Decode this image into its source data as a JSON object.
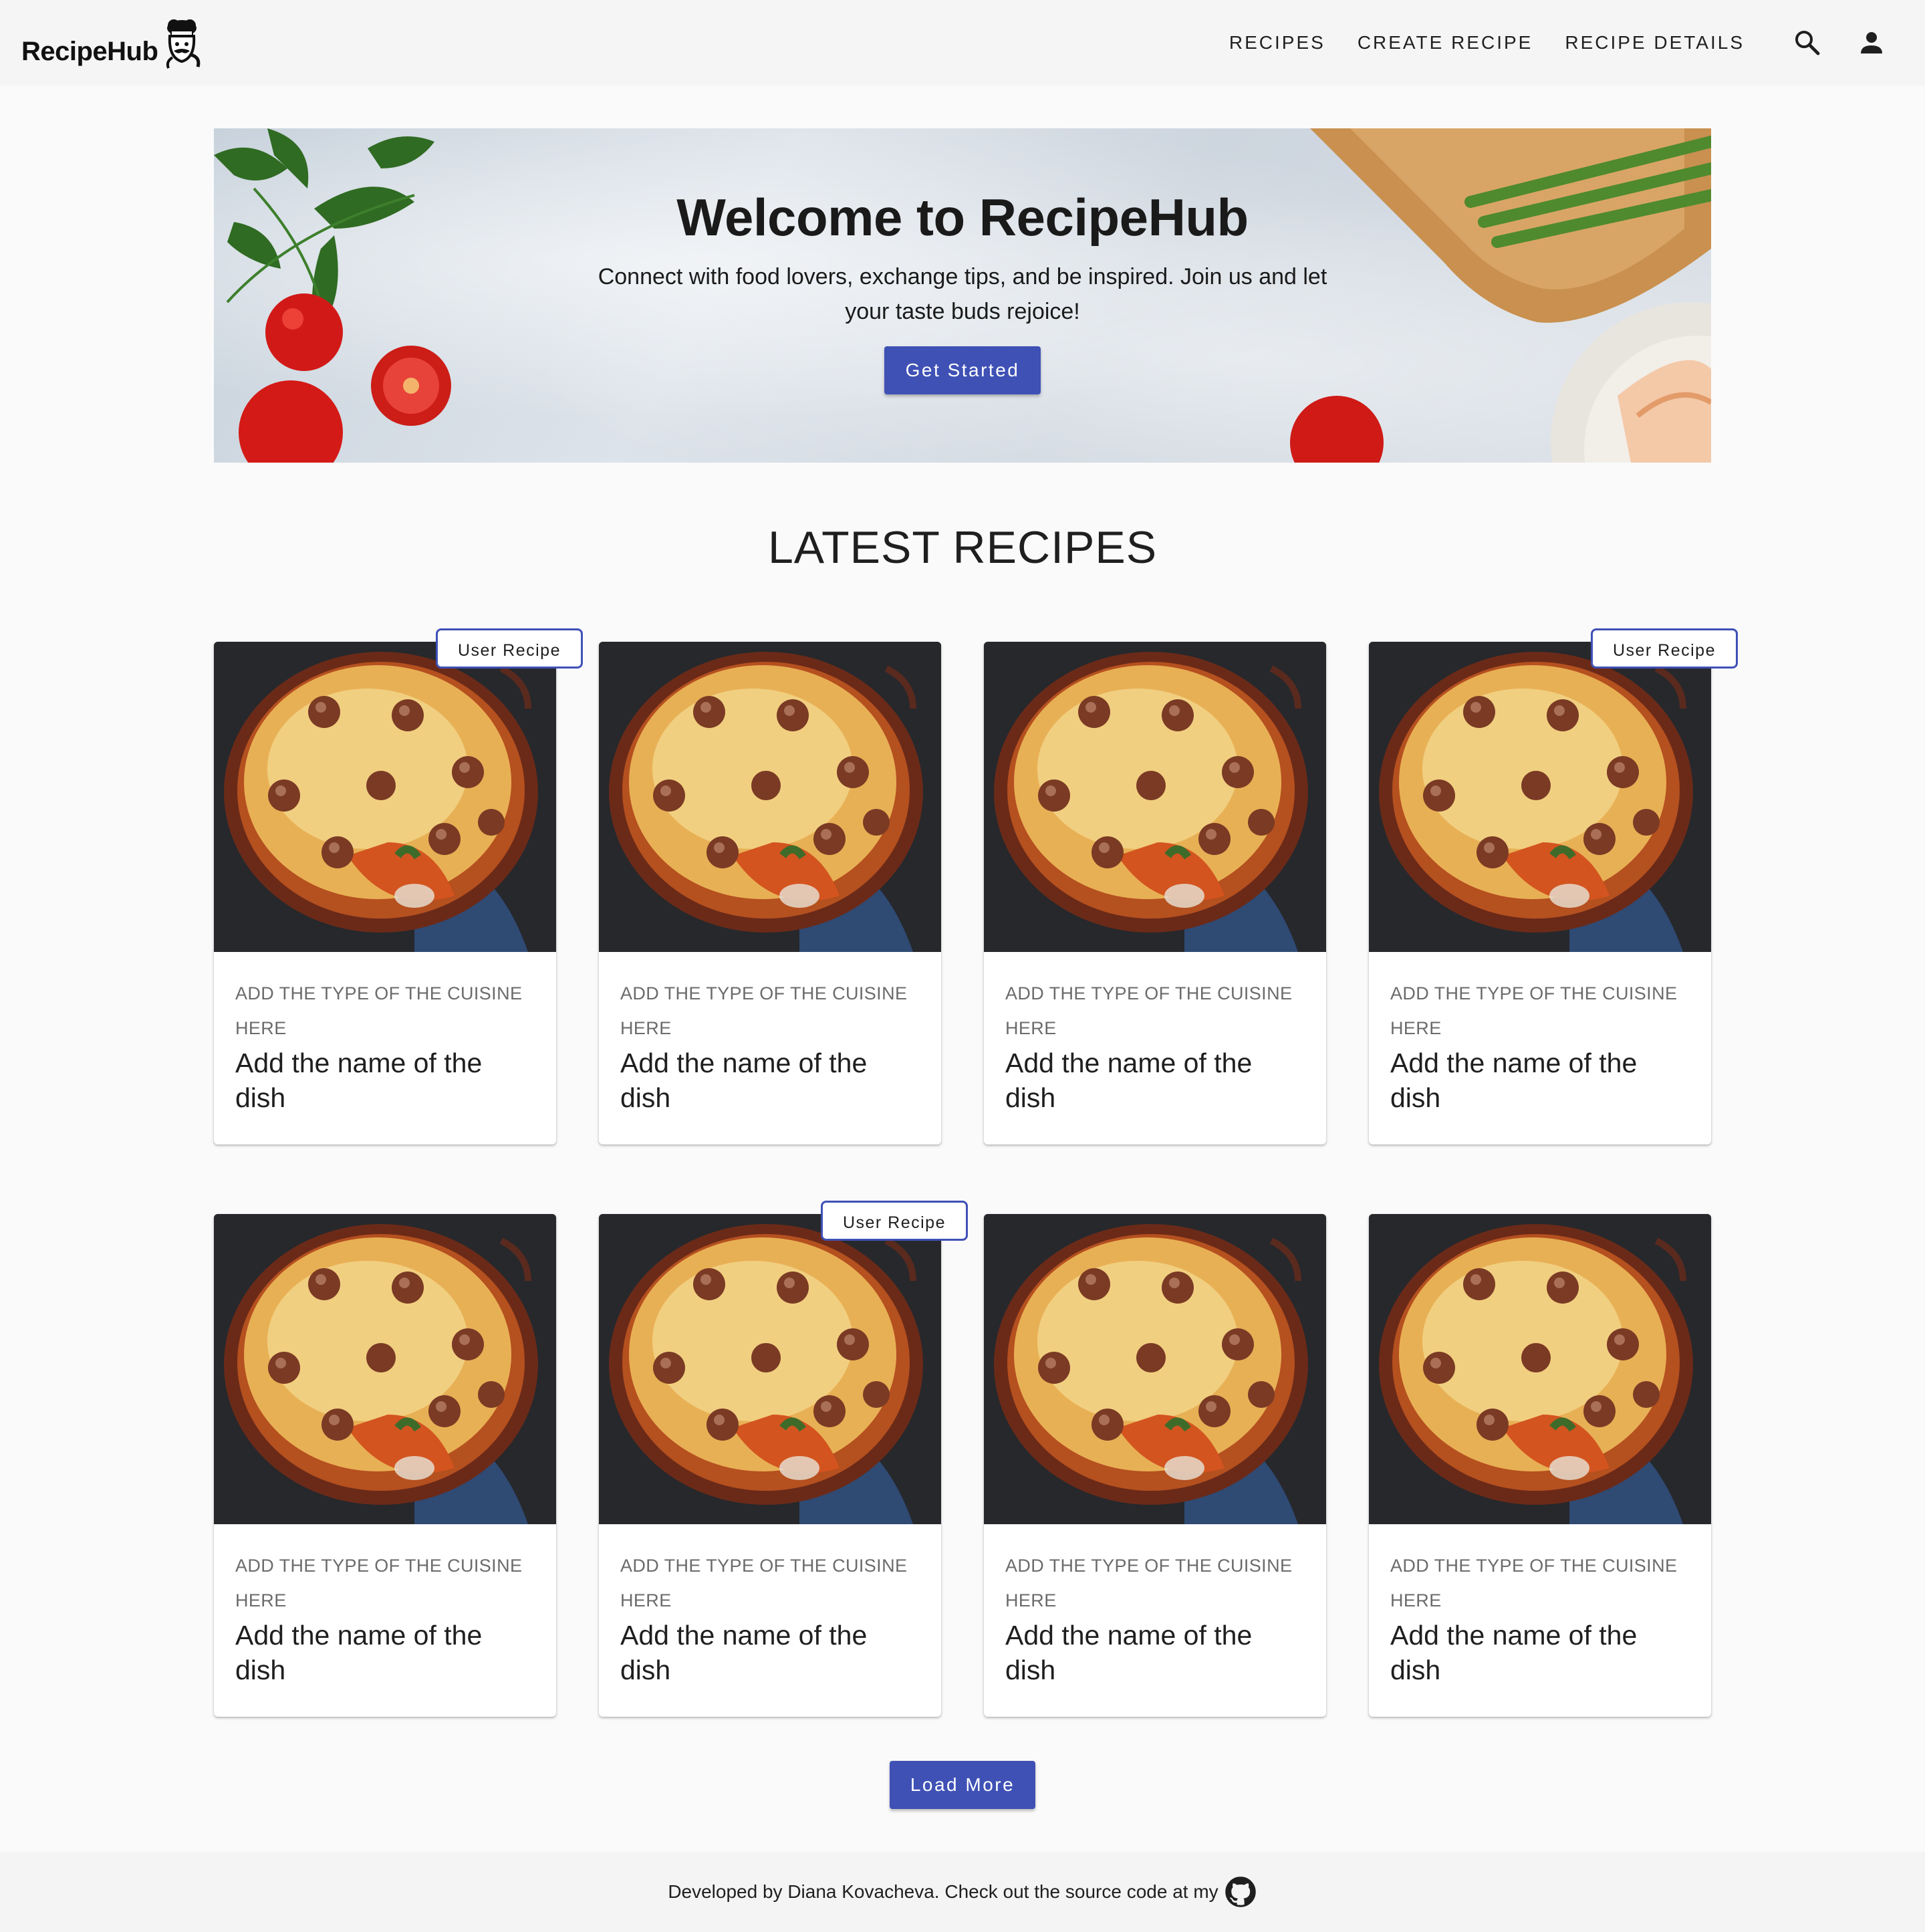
{
  "header": {
    "brand": "RecipeHub",
    "nav": [
      "RECIPES",
      "CREATE RECIPE",
      "RECIPE DETAILS"
    ],
    "search_icon": "search-icon",
    "account_icon": "account-icon"
  },
  "hero": {
    "title": "Welcome to RecipeHub",
    "subtitle": "Connect with food lovers, exchange tips, and be inspired. Join us and let your taste buds rejoice!",
    "cta": "Get Started"
  },
  "latest": {
    "title": "LATEST RECIPES",
    "cards": [
      {
        "type": "ADD THE TYPE OF THE CUISINE HERE",
        "name": "Add the name of the dish",
        "badge": "User Recipe"
      },
      {
        "type": "ADD THE TYPE OF THE CUISINE HERE",
        "name": "Add the name of the dish",
        "badge": ""
      },
      {
        "type": "ADD THE TYPE OF THE CUISINE HERE",
        "name": "Add the name of the dish",
        "badge": ""
      },
      {
        "type": "ADD THE TYPE OF THE CUISINE HERE",
        "name": "Add the name of the dish",
        "badge": "User Recipe"
      },
      {
        "type": "ADD THE TYPE OF THE CUISINE HERE",
        "name": "Add the name of the dish",
        "badge": ""
      },
      {
        "type": "ADD THE TYPE OF THE CUISINE HERE",
        "name": "Add the name of the dish",
        "badge": "User Recipe"
      },
      {
        "type": "ADD THE TYPE OF THE CUISINE HERE",
        "name": "Add the name of the dish",
        "badge": ""
      },
      {
        "type": "ADD THE TYPE OF THE CUISINE HERE",
        "name": "Add the name of the dish",
        "badge": ""
      }
    ],
    "load_more": "Load More"
  },
  "footer": {
    "text": "Developed by Diana Kovacheva. Check out the source code at my",
    "icon": "github-icon"
  },
  "colors": {
    "primary": "#3f51b5",
    "page_bg": "#fafafa",
    "appbar_bg": "#f5f5f5"
  }
}
